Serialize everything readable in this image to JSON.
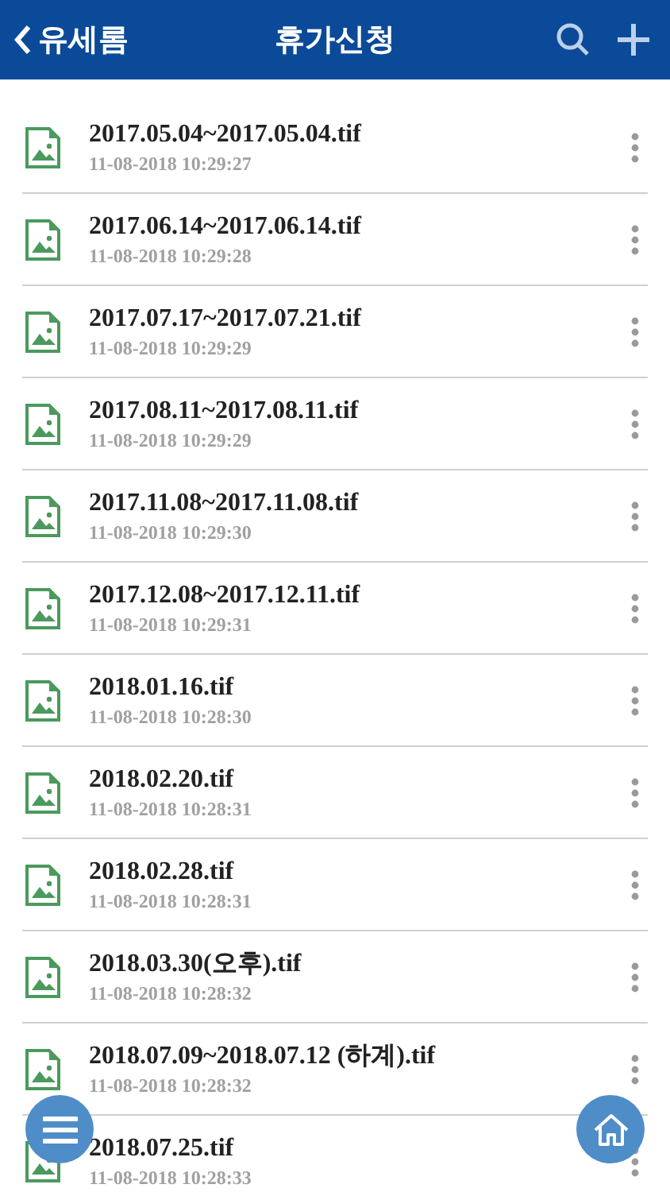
{
  "header": {
    "back_label": "유세롬",
    "title": "휴가신청"
  },
  "files": [
    {
      "name": "2017.05.04~2017.05.04.tif",
      "date": "11-08-2018 10:29:27"
    },
    {
      "name": "2017.06.14~2017.06.14.tif",
      "date": "11-08-2018 10:29:28"
    },
    {
      "name": "2017.07.17~2017.07.21.tif",
      "date": "11-08-2018 10:29:29"
    },
    {
      "name": "2017.08.11~2017.08.11.tif",
      "date": "11-08-2018 10:29:29"
    },
    {
      "name": "2017.11.08~2017.11.08.tif",
      "date": "11-08-2018 10:29:30"
    },
    {
      "name": "2017.12.08~2017.12.11.tif",
      "date": "11-08-2018 10:29:31"
    },
    {
      "name": "2018.01.16.tif",
      "date": "11-08-2018 10:28:30"
    },
    {
      "name": "2018.02.20.tif",
      "date": "11-08-2018 10:28:31"
    },
    {
      "name": "2018.02.28.tif",
      "date": "11-08-2018 10:28:31"
    },
    {
      "name": "2018.03.30(오후).tif",
      "date": "11-08-2018 10:28:32"
    },
    {
      "name": "2018.07.09~2018.07.12 (하계).tif",
      "date": "11-08-2018 10:28:32"
    },
    {
      "name": "2018.07.25.tif",
      "date": "11-08-2018 10:28:33"
    }
  ]
}
